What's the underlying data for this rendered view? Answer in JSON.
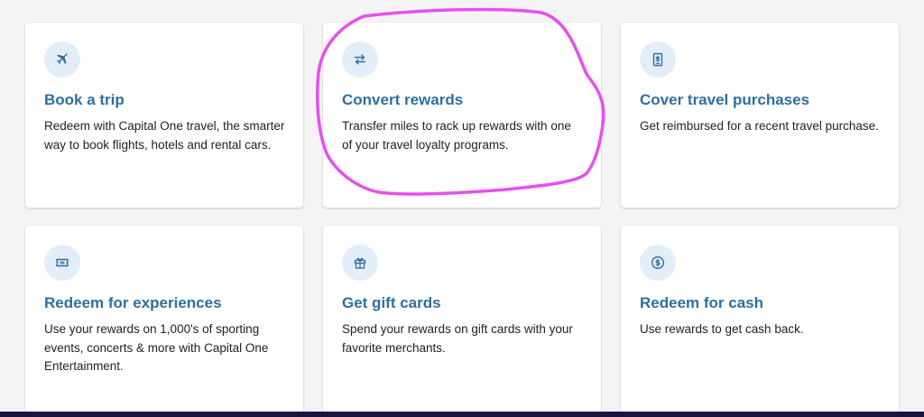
{
  "colors": {
    "background": "#f4f4f4",
    "card": "#ffffff",
    "title": "#2e6f9f",
    "icon_bg": "#e3eef8",
    "icon_fg": "#2e6f9f",
    "annotation": "#e550f0",
    "bottom_bar": "#1c1340"
  },
  "cards": [
    {
      "icon": "airplane-icon",
      "title": "Book a trip",
      "description": "Redeem with Capital One travel, the smarter way to book flights, hotels and rental cars."
    },
    {
      "icon": "swap-arrows-icon",
      "title": "Convert rewards",
      "description": "Transfer miles to rack up rewards with one of your travel loyalty programs."
    },
    {
      "icon": "receipt-icon",
      "title": "Cover travel purchases",
      "description": "Get reimbursed for a recent travel purchase."
    },
    {
      "icon": "ticket-icon",
      "title": "Redeem for experiences",
      "description": "Use your rewards on 1,000's of sporting events, concerts & more with Capital One Entertainment."
    },
    {
      "icon": "gift-icon",
      "title": "Get gift cards",
      "description": "Spend your rewards on gift cards with your favorite merchants."
    },
    {
      "icon": "dollar-coin-icon",
      "title": "Redeem for cash",
      "description": "Use rewards to get cash back."
    }
  ]
}
